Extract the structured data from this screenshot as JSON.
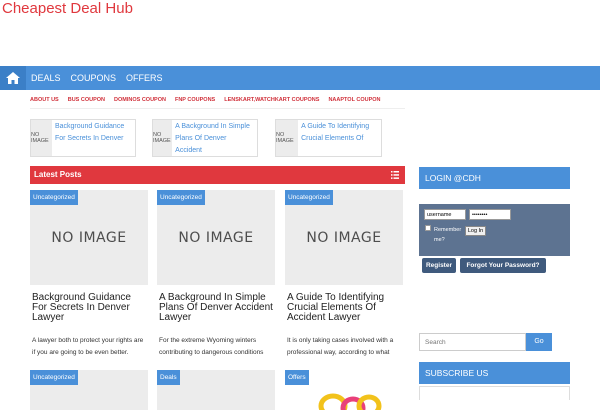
{
  "site": {
    "title": "Cheapest Deal Hub"
  },
  "nav": {
    "items": [
      "DEALS",
      "COUPONS",
      "OFFERS"
    ]
  },
  "subnav": {
    "items": [
      "ABOUT US",
      "BUS COUPON",
      "DOMINOS COUPON",
      "FNP COUPONS",
      "LENSKART,WATCHKART COUPONS",
      "NAAPTOL COUPON"
    ]
  },
  "featured": [
    {
      "thumb": "NO IMAGE",
      "title": "Background Guidance For Secrets In Denver"
    },
    {
      "thumb": "NO IMAGE",
      "title": "A Background In Simple Plans Of Denver Accident"
    },
    {
      "thumb": "NO IMAGE",
      "title": "A Guide To Identifying Crucial Elements Of"
    }
  ],
  "latest": {
    "heading": "Latest Posts",
    "posts": [
      {
        "badge": "Uncategorized",
        "image": "NO IMAGE",
        "title": "Background Guidance For Secrets In Denver Lawyer",
        "excerpt": "A lawyer both to protect your rights are if you are going to be even better."
      },
      {
        "badge": "Uncategorized",
        "image": "NO IMAGE",
        "title": "A Background In Simple Plans Of Denver Accident Lawyer",
        "excerpt": "For the extreme Wyoming winters contributing to dangerous conditions"
      },
      {
        "badge": "Uncategorized",
        "image": "NO IMAGE",
        "title": "A Guide To Identifying Crucial Elements Of Accident Lawyer",
        "excerpt": "It is only taking cases involved with a professional way, according to what"
      }
    ],
    "posts_row2": [
      {
        "badge": "Uncategorized"
      },
      {
        "badge": "Deals"
      },
      {
        "badge": "Offers"
      }
    ]
  },
  "sidebar": {
    "login_heading": "LOGIN @CDH",
    "username_value": "username",
    "password_value": "••••••••",
    "remember_label": "Remember me?",
    "login_button": "Log In",
    "register_button": "Register",
    "forgot_button": "Forgot Your Password?",
    "search_placeholder": "Search",
    "search_button": "Go",
    "subscribe_heading": "SUBSCRIBE US"
  },
  "colors": {
    "brand_red": "#e0383e",
    "nav_blue": "#4a90d9",
    "login_panel": "#5d7391"
  }
}
